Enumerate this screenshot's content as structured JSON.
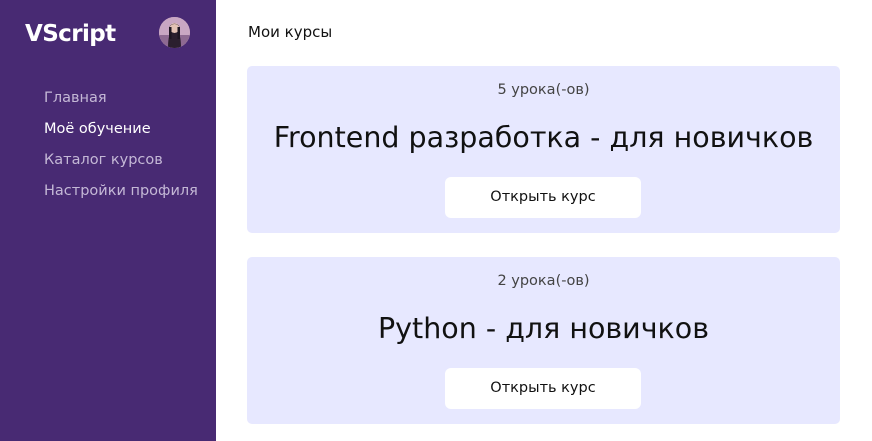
{
  "app": {
    "logo": "VScript"
  },
  "sidebar": {
    "items": [
      {
        "label": "Главная"
      },
      {
        "label": "Моё обучение"
      },
      {
        "label": "Каталог курсов"
      },
      {
        "label": "Настройки профиля"
      }
    ]
  },
  "main": {
    "title": "Мои курсы",
    "courses": [
      {
        "lessons": "5 урока(-ов)",
        "title": "Frontend разработка - для новичков",
        "button": "Открыть курс"
      },
      {
        "lessons": "2 урока(-ов)",
        "title": "Python - для новичков",
        "button": "Открыть курс"
      }
    ]
  },
  "colors": {
    "sidebar_bg": "#482a73",
    "card_bg": "#e7e8ff",
    "nav_active": "#ffffff",
    "nav_muted": "#c4b8d6"
  }
}
